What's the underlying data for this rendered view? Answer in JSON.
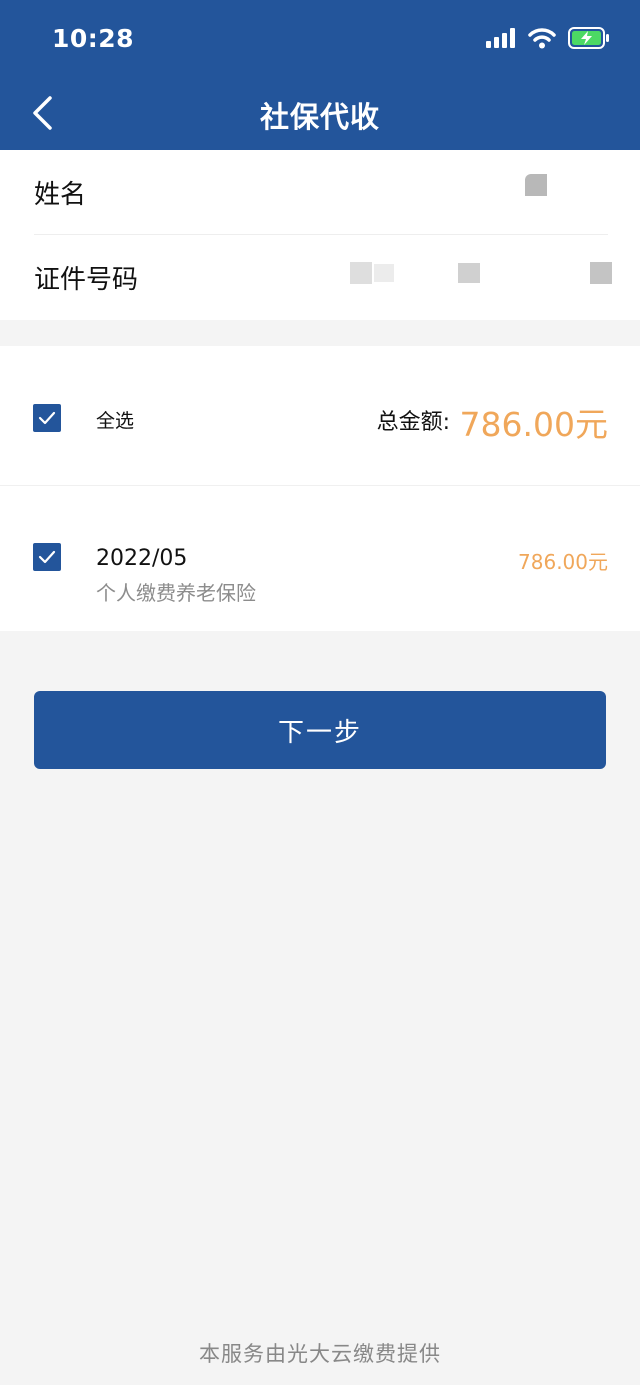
{
  "status_bar": {
    "time": "10:28"
  },
  "header": {
    "title": "社保代收"
  },
  "info": {
    "name_label": "姓名",
    "id_label": "证件号码"
  },
  "selection": {
    "select_all_label": "全选",
    "total_label": "总金额:",
    "total_amount": "786.00元",
    "items": [
      {
        "date": "2022/05",
        "description": "个人缴费养老保险",
        "amount": "786.00元",
        "checked": true
      }
    ]
  },
  "actions": {
    "next_label": "下一步"
  },
  "footer": {
    "text": "本服务由光大云缴费提供"
  },
  "colors": {
    "primary": "#23559b",
    "amount": "#f0a75a",
    "background": "#f4f4f4"
  }
}
